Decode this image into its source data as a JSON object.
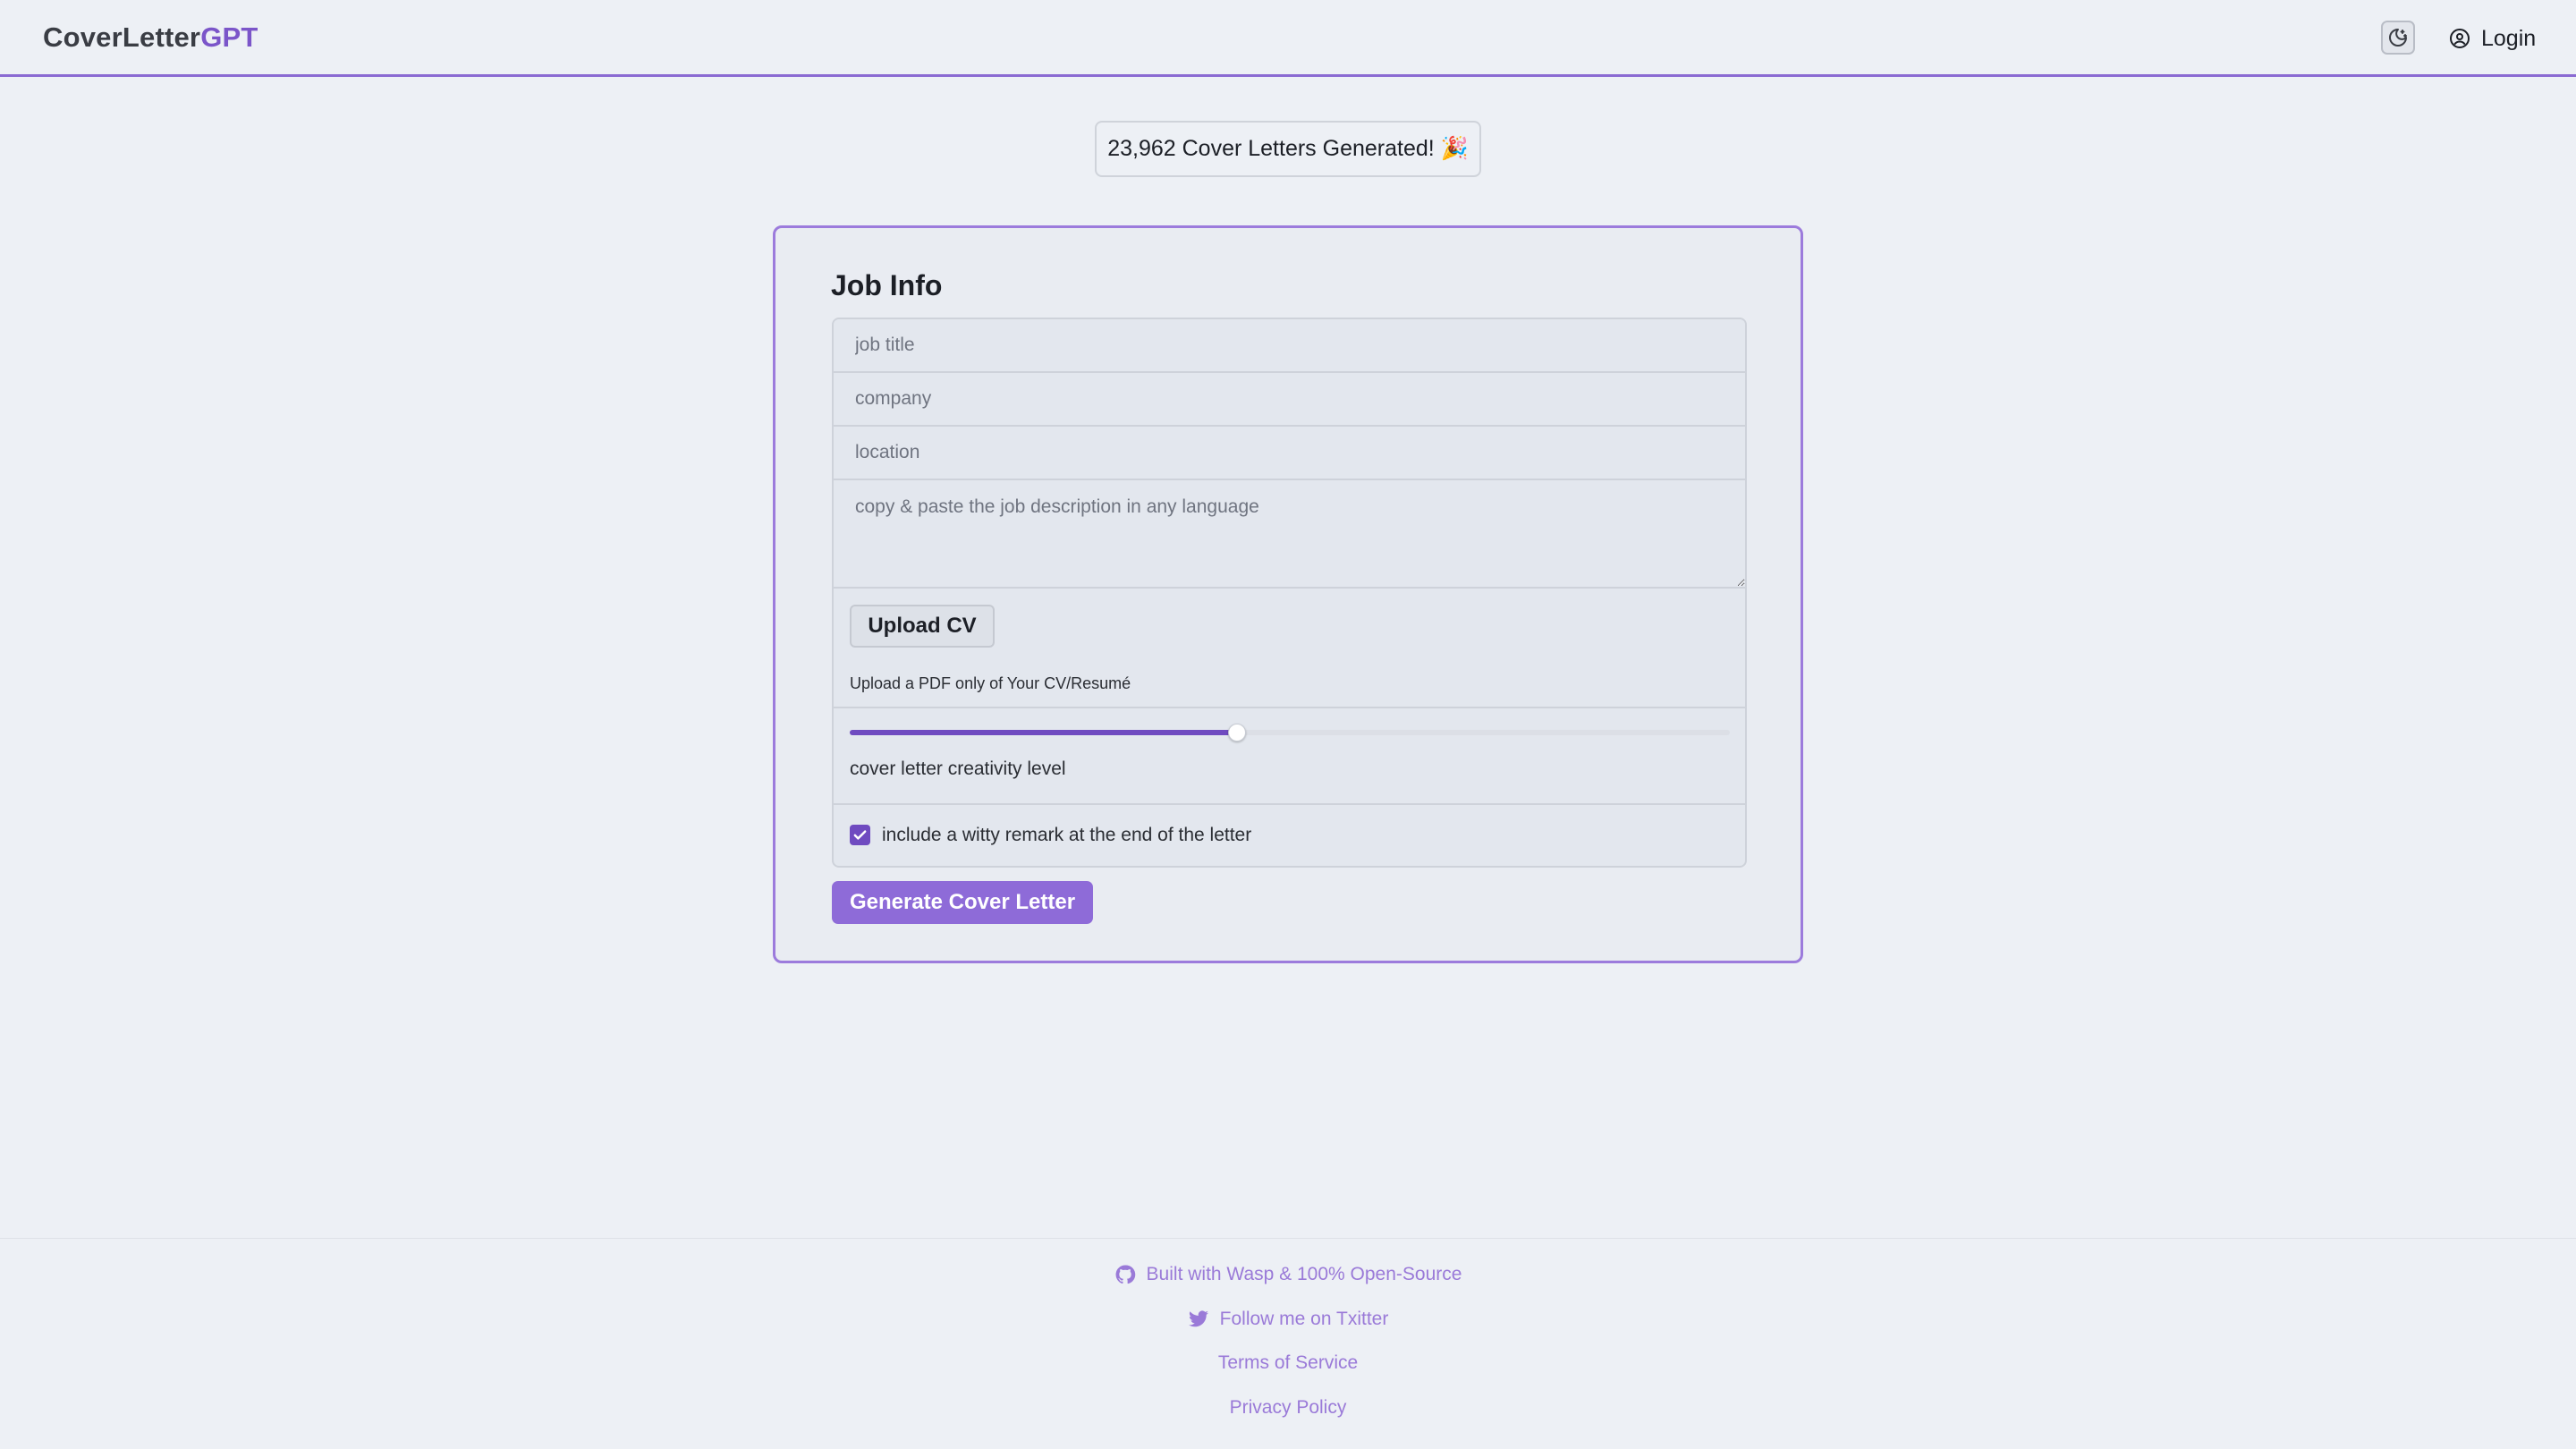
{
  "header": {
    "brand_part1": "CoverLetter",
    "brand_part2": "GPT",
    "login_label": "Login",
    "theme_icon": "moon-stars-icon",
    "login_icon": "user-circle-icon"
  },
  "counter": {
    "text": "23,962 Cover Letters Generated! 🎉"
  },
  "form": {
    "title": "Job Info",
    "job_title_placeholder": "job title",
    "company_placeholder": "company",
    "location_placeholder": "location",
    "description_placeholder": "copy & paste the job description in any language",
    "upload_label": "Upload CV",
    "upload_hint": "Upload a PDF only of Your CV/Resumé",
    "creativity_label": "cover letter creativity level",
    "creativity_value": 0.44,
    "witty_label": "include a witty remark at the end of the letter",
    "witty_checked": true,
    "generate_label": "Generate Cover Letter"
  },
  "footer": {
    "github_label": "Built with Wasp & 100% Open-Source",
    "twitter_label": "Follow me on Txitter",
    "terms_label": "Terms of Service",
    "privacy_label": "Privacy Policy"
  },
  "colors": {
    "accent": "#7b55c9",
    "button": "#8e6bd8",
    "link": "#9a7ad8",
    "background": "#edf0f5"
  }
}
